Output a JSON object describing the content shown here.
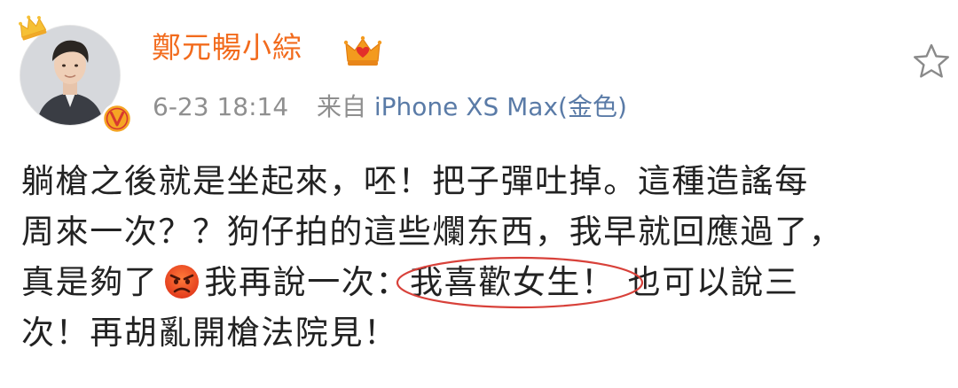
{
  "post": {
    "username": "鄭元暢小綜",
    "timestamp": "6-23 18:14",
    "source_prefix": "来自",
    "source": "iPhone XS Max(金色)",
    "body": {
      "line1": "躺槍之後就是坐起來，呸！把子彈吐掉。這種造謠每",
      "line2": "周來一次？？狗仔拍的這些爛东西，我早就回應過了，",
      "line3_before": "真是夠了",
      "line3_mid": "我再說一次：",
      "line3_circled": "我喜歡女生！",
      "line3_after": "也可以說三",
      "line4": "次！再胡亂開槍法院見！"
    }
  },
  "icons": {
    "crown": "crown-icon",
    "verified": "verified-v-icon",
    "vip": "vip-crown-icon",
    "favorite": "star-outline-icon",
    "emoji": "angry-face-emoji"
  },
  "colors": {
    "username": "#f26b1d",
    "meta": "#8f8f8f",
    "source_link": "#5a7ba7",
    "circle_mark": "#d8413a",
    "verified_badge": "#f5a524"
  }
}
